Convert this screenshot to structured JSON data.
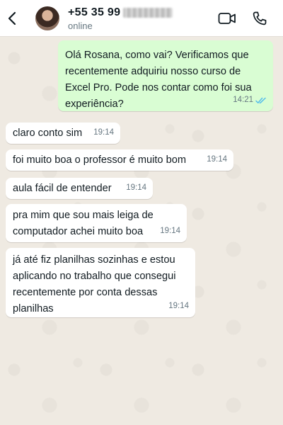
{
  "header": {
    "phone": "+55 35 99",
    "status": "online"
  },
  "icons": {
    "back": "back-arrow-icon",
    "video": "video-call-icon",
    "call": "phone-call-icon"
  },
  "colors": {
    "outgoing_bubble": "#d9fdd3",
    "incoming_bubble": "#ffffff",
    "chat_background": "#efeae2",
    "read_ticks": "#53bdeb"
  },
  "messages": [
    {
      "direction": "outgoing",
      "text": "Olá Rosana, como vai? Verificamos que recentemente adquiriu nosso curso de Excel Pro. Pode nos contar como foi sua experiência?",
      "time": "14:21",
      "read": true
    },
    {
      "direction": "incoming",
      "text": "claro conto sim",
      "time": "19:14"
    },
    {
      "direction": "incoming",
      "text": "foi muito boa o professor é muito bom",
      "time": "19:14"
    },
    {
      "direction": "incoming",
      "text": "aula fácil de entender",
      "time": "19:14"
    },
    {
      "direction": "incoming",
      "text": "pra mim que sou mais leiga de computador achei muito boa",
      "time": "19:14"
    },
    {
      "direction": "incoming",
      "text": "já até fiz planilhas sozinhas e estou aplicando no trabalho que consegui recentemente por conta dessas planilhas",
      "time": "19:14"
    }
  ]
}
